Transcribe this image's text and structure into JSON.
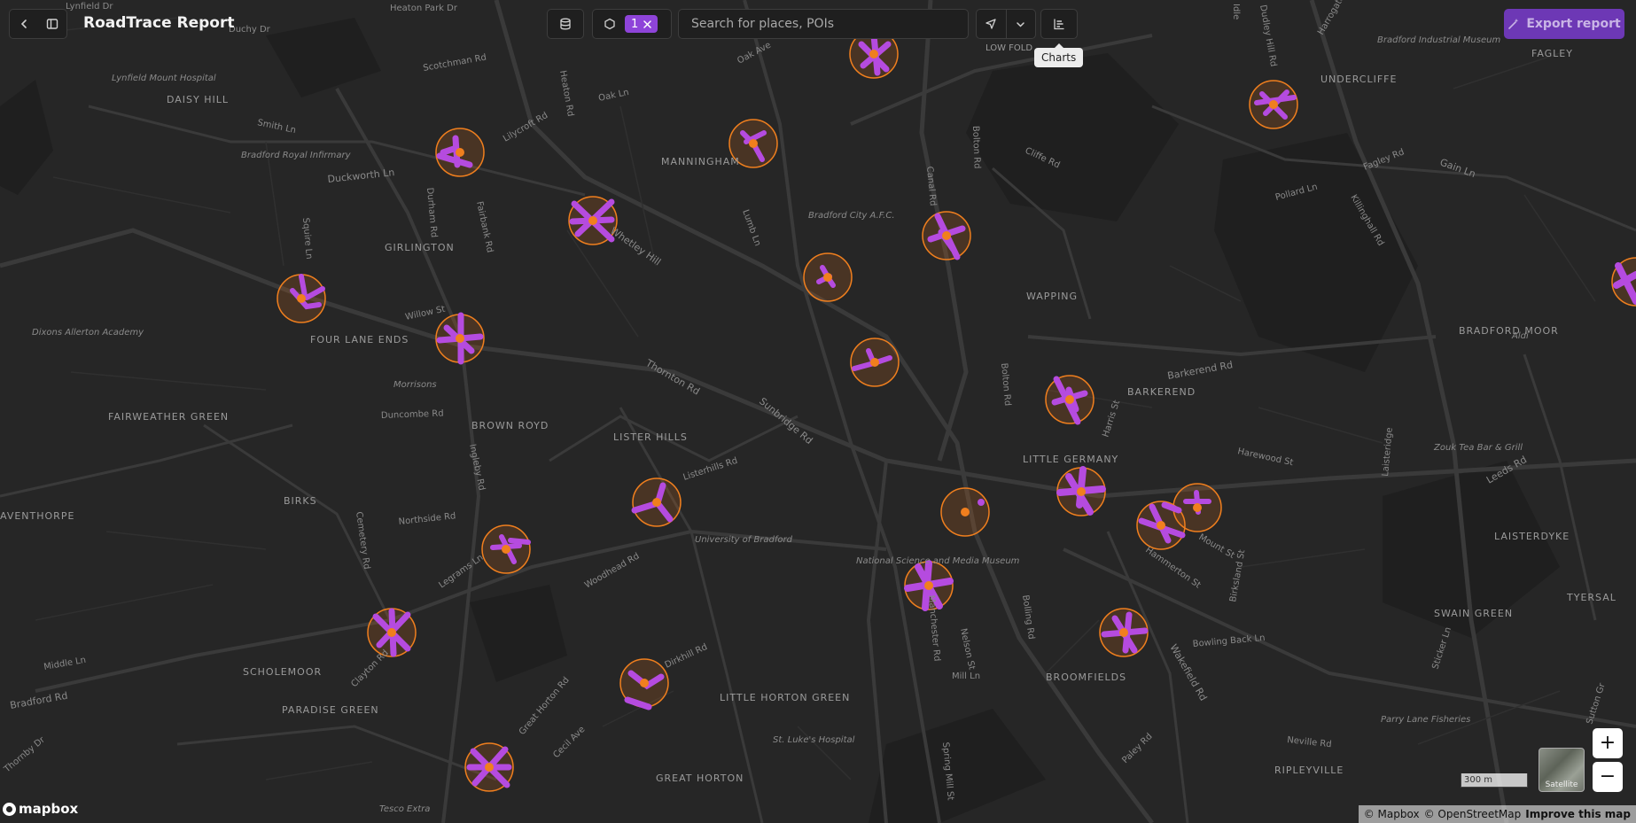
{
  "header": {
    "title": "RoadTrace Report",
    "filter_count": "1",
    "search_placeholder": "Search for places, POIs",
    "tooltip": "Charts",
    "export_label": "Export report"
  },
  "map": {
    "scale_label": "300 m",
    "satellite_label": "Satellite",
    "logo_text": "mapbox",
    "attribution": {
      "mapbox": "© Mapbox",
      "osm": "© OpenStreetMap",
      "improve": "Improve this map"
    },
    "labels": [
      {
        "text": "Lynfield Dr"
      },
      {
        "text": "Heaton Park Dr"
      },
      {
        "text": "Duchy Dr"
      },
      {
        "text": "Scotchman Rd"
      },
      {
        "text": "Oak Ave"
      },
      {
        "text": "Oak Ln"
      },
      {
        "text": "LOW FOLD"
      },
      {
        "text": "Idle"
      },
      {
        "text": "Dudley Hill Rd"
      },
      {
        "text": "Harrogate Rd"
      },
      {
        "text": "Bradford Industrial Museum"
      },
      {
        "text": "FAGLEY"
      },
      {
        "text": "Lynfield Mount Hospital"
      },
      {
        "text": "DAISY HILL"
      },
      {
        "text": "UNDERCLIFFE"
      },
      {
        "text": "Heaton Rd"
      },
      {
        "text": "Smith Ln"
      },
      {
        "text": "Lilycroft Rd"
      },
      {
        "text": "Bradford Royal Infirmary"
      },
      {
        "text": "MANNINGHAM"
      },
      {
        "text": "Duckworth Ln"
      },
      {
        "text": "Bolton Rd"
      },
      {
        "text": "Cliffe Rd"
      },
      {
        "text": "Fagley Rd"
      },
      {
        "text": "Gain Ln"
      },
      {
        "text": "Pollard Ln"
      },
      {
        "text": "Killinghall Rd"
      },
      {
        "text": "Durham Rd"
      },
      {
        "text": "Fairbank Rd"
      },
      {
        "text": "Canal Rd"
      },
      {
        "text": "Bradford City A.F.C."
      },
      {
        "text": "Lumb Ln"
      },
      {
        "text": "Whetley Hill"
      },
      {
        "text": "Squire Ln"
      },
      {
        "text": "GIRLINGTON"
      },
      {
        "text": "WAPPING"
      },
      {
        "text": "Willow St"
      },
      {
        "text": "Dixons Allerton Academy"
      },
      {
        "text": "FOUR LANE ENDS"
      },
      {
        "text": "BRADFORD MOOR"
      },
      {
        "text": "Aldi"
      },
      {
        "text": "Thornton Rd"
      },
      {
        "text": "Barkerend Rd"
      },
      {
        "text": "Morrisons"
      },
      {
        "text": "Sunbridge Rd"
      },
      {
        "text": "BARKEREND"
      },
      {
        "text": "Bolton Rd"
      },
      {
        "text": "FAIRWEATHER GREEN"
      },
      {
        "text": "Duncombe Rd"
      },
      {
        "text": "BROWN ROYD"
      },
      {
        "text": "LISTER HILLS"
      },
      {
        "text": "Harris St"
      },
      {
        "text": "Ingleby Rd"
      },
      {
        "text": "Listerhills Rd"
      },
      {
        "text": "LITTLE GERMANY"
      },
      {
        "text": "Harewood St"
      },
      {
        "text": "Zouk Tea Bar & Grill"
      },
      {
        "text": "Laisteridge"
      },
      {
        "text": "Leeds Rd"
      },
      {
        "text": "AVENTHORPE"
      },
      {
        "text": "BIRKS"
      },
      {
        "text": "Northside Rd"
      },
      {
        "text": "Cemetery Rd"
      },
      {
        "text": "University of Bradford"
      },
      {
        "text": "Mount St"
      },
      {
        "text": "Hammerton St"
      },
      {
        "text": "LAISTERDYKE"
      },
      {
        "text": "Woodhead Rd"
      },
      {
        "text": "National Science and Media Museum"
      },
      {
        "text": "Legrams Ln"
      },
      {
        "text": "Birksland St"
      },
      {
        "text": "TYERSAL"
      },
      {
        "text": "SWAIN GREEN"
      },
      {
        "text": "Bowling Back Ln"
      },
      {
        "text": "Bolling Rd"
      },
      {
        "text": "Nelson St"
      },
      {
        "text": "Manchester Rd"
      },
      {
        "text": "Middle Ln"
      },
      {
        "text": "SCHOLEMOOR"
      },
      {
        "text": "Clayton Rd"
      },
      {
        "text": "Dirkhill Rd"
      },
      {
        "text": "Mill Ln"
      },
      {
        "text": "BROOMFIELDS"
      },
      {
        "text": "Wakefield Rd"
      },
      {
        "text": "Sticker Ln"
      },
      {
        "text": "Bradford Rd"
      },
      {
        "text": "PARADISE GREEN"
      },
      {
        "text": "Great Horton Rd"
      },
      {
        "text": "LITTLE HORTON GREEN"
      },
      {
        "text": "Parry Lane Fisheries"
      },
      {
        "text": "Cecil Ave"
      },
      {
        "text": "St. Luke's Hospital"
      },
      {
        "text": "Spring Mill St"
      },
      {
        "text": "Neville Rd"
      },
      {
        "text": "Thornby Dr"
      },
      {
        "text": "Paley Rd"
      },
      {
        "text": "RIPLEYVILLE"
      },
      {
        "text": "GREAT HORTON"
      },
      {
        "text": "Tesco Extra"
      },
      {
        "text": "Sutton Gr"
      }
    ]
  },
  "colors": {
    "background": "#262626",
    "road": "#3a3a3a",
    "zone_stroke": "#f07f1e",
    "zone_fill": "#e8741e",
    "trace": "#b54bdf",
    "accent": "#8e44d9"
  },
  "icons": {
    "back": "chevron-left-icon",
    "sidebar": "sidebar-toggle-icon",
    "database": "database-icon",
    "polygon": "hexagon-icon",
    "clear": "close-icon",
    "select": "cursor-icon",
    "dropdown": "chevron-down-icon",
    "charts": "bar-chart-icon",
    "export": "magic-wand-icon"
  }
}
